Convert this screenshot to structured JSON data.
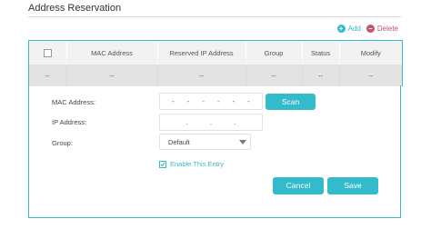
{
  "section": {
    "title": "Address Reservation"
  },
  "actions": {
    "add_label": "Add",
    "delete_label": "Delete",
    "add_icon": "plus-circle-icon",
    "delete_icon": "minus-circle-icon"
  },
  "table": {
    "headers": [
      "",
      "MAC Address",
      "Reserved IP Address",
      "Group",
      "Status",
      "Modify"
    ],
    "rows": [
      [
        "--",
        "--",
        "--",
        "--",
        "--",
        "--"
      ]
    ]
  },
  "form": {
    "mac_label": "MAC Address:",
    "mac_placeholder": "- - - - - -",
    "ip_label": "IP Address:",
    "ip_placeholder": ". . .",
    "group_label": "Group:",
    "group_value": "Default",
    "enable_label": "Enable This Entry",
    "enable_checked": true,
    "scan_label": "Scan",
    "cancel_label": "Cancel",
    "save_label": "Save"
  },
  "colors": {
    "accent": "#33bbcb",
    "delete": "#c0546b"
  }
}
